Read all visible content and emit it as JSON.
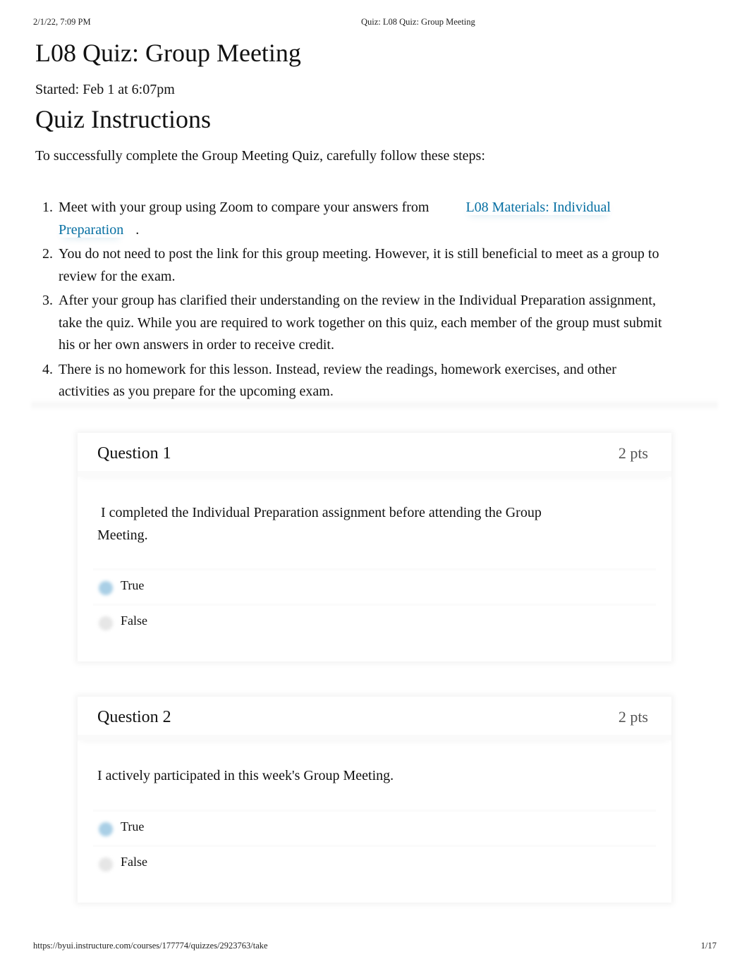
{
  "print_header": {
    "datetime": "2/1/22, 7:09 PM",
    "document_title": "Quiz: L08 Quiz: Group Meeting"
  },
  "quiz": {
    "title": "L08 Quiz: Group Meeting",
    "started": "Started: Feb 1 at 6:07pm",
    "instructions_heading": "Quiz Instructions",
    "intro": "To successfully complete the Group Meeting Quiz, carefully follow these steps:",
    "link_color": "#0770a3",
    "steps": [
      {
        "number": "1.",
        "text_before": "Meet with your group using Zoom to compare your answers from",
        "link_line1": "L08 Materials: Individual",
        "link_line2": "Preparation",
        "text_after": "."
      },
      {
        "number": "2.",
        "text": "You do not need to post the link for this group meeting. However, it is still beneficial to meet as a group to review for the exam."
      },
      {
        "number": "3.",
        "text": "After your group has clarified their understanding on the review in the Individual Preparation assignment, take the quiz. While you are required to work together on this quiz, each member of the group must submit his or her own answers in order to receive credit."
      },
      {
        "number": "4.",
        "text": "There is no homework for this lesson. Instead, review the readings, homework exercises, and other activities as you prepare for the upcoming exam."
      }
    ]
  },
  "questions": [
    {
      "title": "Question 1",
      "points": "2 pts",
      "text": " I completed the Individual Preparation assignment before attending the Group Meeting.",
      "answers": [
        {
          "label": "True",
          "selected": true
        },
        {
          "label": "False",
          "selected": false
        }
      ]
    },
    {
      "title": "Question 2",
      "points": "2 pts",
      "text": "I actively participated in this week's Group Meeting.",
      "answers": [
        {
          "label": "True",
          "selected": true
        },
        {
          "label": "False",
          "selected": false
        }
      ]
    }
  ],
  "print_footer": {
    "url": "https://byui.instructure.com/courses/177774/quizzes/2923763/take",
    "page": "1/17"
  }
}
